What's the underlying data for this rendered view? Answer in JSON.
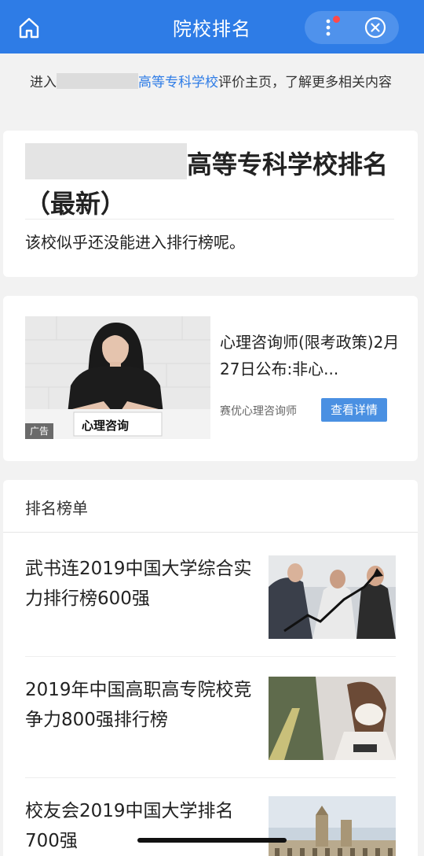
{
  "navbar": {
    "title": "院校排名",
    "home_icon": "home-icon",
    "more_icon": "more-vertical-icon",
    "close_icon": "close-circle-icon",
    "notification_dot_color": "#ff4a4a",
    "bg_color": "#2e7ce6"
  },
  "notice": {
    "prefix": "进入",
    "link_text": "高等专科学校",
    "suffix": "评价主页，了解更多相关内容"
  },
  "ranking_title_card": {
    "title_after_redaction": "高等专科学校排名（最新）",
    "note": "该校似乎还没能进入排行榜呢。"
  },
  "ad": {
    "image_caption": "心理咨询",
    "tag": "广告",
    "title": "心理咨询师(限考政策)2月27日公布:非心...",
    "source": "赛优心理咨询师",
    "button_label": "查看详情"
  },
  "ranking_list": {
    "header": "排名榜单",
    "items": [
      {
        "title": "武书连2019中国大学综合实力排行榜600强"
      },
      {
        "title": "2019年中国高职高专院校竞争力800强排行榜"
      },
      {
        "title": "校友会2019中国大学排名700强"
      }
    ]
  }
}
